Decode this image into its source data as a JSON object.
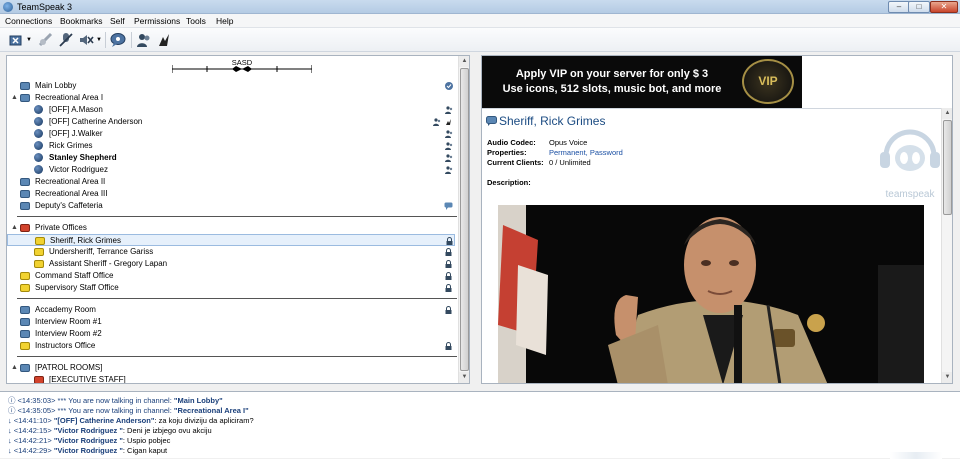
{
  "window": {
    "title": "TeamSpeak 3"
  },
  "menu": [
    "Connections",
    "Bookmarks",
    "Self",
    "Permissions",
    "Tools",
    "Help"
  ],
  "toolbar": {
    "icons": [
      "connect-icon",
      "disconnect-icon",
      "mute-mic-icon",
      "mute-speakers-icon",
      "chat-icon",
      "contacts-icon",
      "away-icon"
    ]
  },
  "server": {
    "name": "SASD"
  },
  "tree": [
    {
      "kind": "channel",
      "label": "Main Lobby",
      "color": "blue",
      "indent": 0,
      "exp": "",
      "right": "check"
    },
    {
      "kind": "channel",
      "label": "Recreational Area I",
      "color": "blue",
      "indent": 0,
      "exp": "▲",
      "right": ""
    },
    {
      "kind": "user",
      "label": "[OFF] A.Mason",
      "indent": 1,
      "right": "user"
    },
    {
      "kind": "user",
      "label": "[OFF] Catherine Anderson",
      "indent": 1,
      "right": "user2"
    },
    {
      "kind": "user",
      "label": "[OFF] J.Walker",
      "indent": 1,
      "right": "user"
    },
    {
      "kind": "user",
      "label": "Rick Grimes",
      "indent": 1,
      "right": "user"
    },
    {
      "kind": "user",
      "label": "Stanley Shepherd",
      "indent": 1,
      "right": "user",
      "bold": true
    },
    {
      "kind": "user",
      "label": "Victor Rodriguez",
      "indent": 1,
      "right": "user"
    },
    {
      "kind": "channel",
      "label": "Recreational Area II",
      "color": "blue",
      "indent": 0,
      "exp": "",
      "right": ""
    },
    {
      "kind": "channel",
      "label": "Recreational Area III",
      "color": "blue",
      "indent": 0,
      "exp": "",
      "right": ""
    },
    {
      "kind": "channel",
      "label": "Deputy's Caffeteria",
      "color": "blue",
      "indent": 0,
      "exp": "",
      "right": "chat"
    },
    {
      "kind": "sep"
    },
    {
      "kind": "channel",
      "label": "Private Offices",
      "color": "red",
      "indent": 0,
      "exp": "▲",
      "right": ""
    },
    {
      "kind": "channel",
      "label": "Sheriff, Rick Grimes",
      "color": "yellow",
      "indent": 1,
      "exp": "",
      "right": "lock",
      "selected": true
    },
    {
      "kind": "channel",
      "label": "Undersheriff, Terrance Gariss",
      "color": "yellow",
      "indent": 1,
      "exp": "",
      "right": "lock"
    },
    {
      "kind": "channel",
      "label": "Assistant Sheriff - Gregory Lapan",
      "color": "yellow",
      "indent": 1,
      "exp": "",
      "right": "lock"
    },
    {
      "kind": "channel",
      "label": "Command Staff Office",
      "color": "yellow",
      "indent": 0,
      "exp": "",
      "right": "lock"
    },
    {
      "kind": "channel",
      "label": "Supervisory Staff Office",
      "color": "yellow",
      "indent": 0,
      "exp": "",
      "right": "lock"
    },
    {
      "kind": "sep"
    },
    {
      "kind": "channel",
      "label": "Accademy Room",
      "color": "blue",
      "indent": 0,
      "exp": "",
      "right": "lock"
    },
    {
      "kind": "channel",
      "label": "Interview Room #1",
      "color": "blue",
      "indent": 0,
      "exp": "",
      "right": ""
    },
    {
      "kind": "channel",
      "label": "Interview Room #2",
      "color": "blue",
      "indent": 0,
      "exp": "",
      "right": ""
    },
    {
      "kind": "channel",
      "label": "Instructors Office",
      "color": "yellow",
      "indent": 0,
      "exp": "",
      "right": "lock"
    },
    {
      "kind": "sep"
    },
    {
      "kind": "channel",
      "label": "[PATROL ROOMS]",
      "color": "blue",
      "indent": 0,
      "exp": "▲",
      "right": ""
    },
    {
      "kind": "channel",
      "label": "[EXECUTIVE STAFF]",
      "color": "red",
      "indent": 1,
      "exp": "",
      "right": ""
    }
  ],
  "banner": {
    "line1": "Apply VIP on your server for only $ 3",
    "line2": "Use icons, 512 slots, music bot, and more",
    "badge": "VIP"
  },
  "channel_info": {
    "title": "Sheriff, Rick Grimes",
    "codec_label": "Audio Codec:",
    "codec_value": "Opus Voice",
    "props_label": "Properties:",
    "props_value": "Permanent, Password",
    "clients_label": "Current Clients:",
    "clients_value": "0 / Unlimited",
    "desc_label": "Description:",
    "watermark": "teamspeak"
  },
  "chat": [
    {
      "ts": "<14:35:03>",
      "text": " *** You are now talking in channel: ",
      "target": "\"Main Lobby\"",
      "kind": "sys"
    },
    {
      "ts": "<14:35:05>",
      "text": " *** You are now talking in channel: ",
      "target": "\"Recreational Area I\"",
      "kind": "sys"
    },
    {
      "ts": "<14:41:10>",
      "name": "\"[OFF] Catherine Anderson\"",
      "msg": ": za koju diviziju da apliciram?",
      "kind": "msg"
    },
    {
      "ts": "<14:42:15>",
      "name": "\"Victor Rodriguez \"",
      "msg": ": Deni je izbjego ovu akciju",
      "kind": "msg"
    },
    {
      "ts": "<14:42:21>",
      "name": "\"Victor Rodriguez \"",
      "msg": ": Uspio pobjec",
      "kind": "msg"
    },
    {
      "ts": "<14:42:29>",
      "name": "\"Victor Rodriguez \"",
      "msg": ": Cigan kaput",
      "kind": "msg"
    }
  ]
}
